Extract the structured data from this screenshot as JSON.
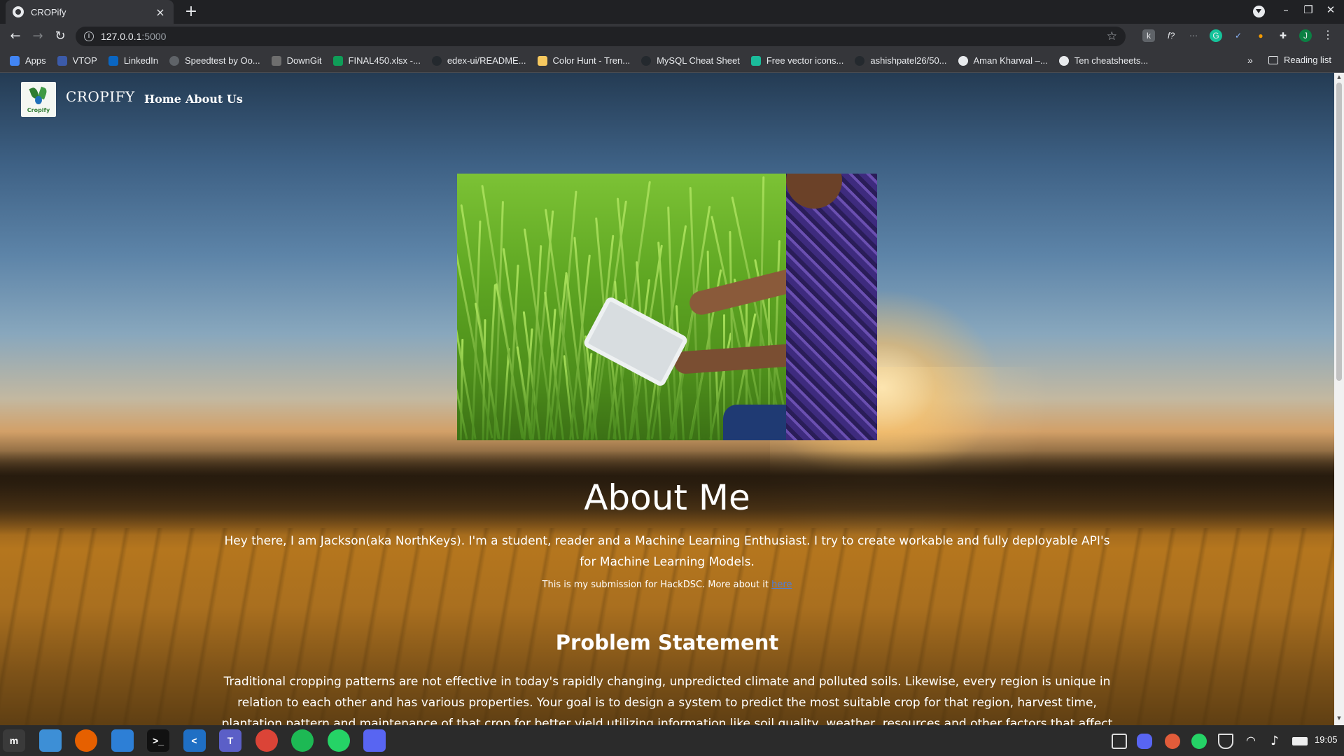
{
  "browser": {
    "tab_title": "CROPify",
    "tab_close": "×",
    "new_tab": "+",
    "url_host": "127.0.0.1",
    "url_port": ":5000",
    "back": "←",
    "forward": "→",
    "reload": "↻",
    "star": "☆",
    "window_minimize": "–",
    "window_restore": "❐",
    "window_close": "✕",
    "extensions": [
      "k",
      "f?",
      "⋯",
      "G",
      "✓",
      "●",
      "✚",
      "J"
    ],
    "menu": "⋮"
  },
  "bookmarks": {
    "items": [
      {
        "label": "Apps",
        "icon": "apps-grid-icon",
        "color": "#4285f4"
      },
      {
        "label": "VTOP",
        "icon": "vtop-icon",
        "color": "#3c5ba9"
      },
      {
        "label": "LinkedIn",
        "icon": "linkedin-icon",
        "color": "#0a66c2"
      },
      {
        "label": "Speedtest by Oo...",
        "icon": "speedtest-icon",
        "color": "#5f6368"
      },
      {
        "label": "DownGit",
        "icon": "downgit-icon",
        "color": "#6e6e6e"
      },
      {
        "label": "FINAL450.xlsx -...",
        "icon": "google-drive-icon",
        "color": "#0f9d58"
      },
      {
        "label": "edex-ui/README...",
        "icon": "github-icon",
        "color": "#24292e"
      },
      {
        "label": "Color Hunt - Tren...",
        "icon": "colorhunt-icon",
        "color": "#f6c85f"
      },
      {
        "label": "MySQL Cheat Sheet",
        "icon": "github-icon",
        "color": "#24292e"
      },
      {
        "label": "Free vector icons...",
        "icon": "flaticon-icon",
        "color": "#1bbc9b"
      },
      {
        "label": "ashishpatel26/50...",
        "icon": "github-icon",
        "color": "#24292e"
      },
      {
        "label": "Aman Kharwal –...",
        "icon": "globe-icon",
        "color": "#e8eaed"
      },
      {
        "label": "Ten cheatsheets...",
        "icon": "globe-icon",
        "color": "#e8eaed"
      }
    ],
    "more": "»",
    "reading_list": "Reading list"
  },
  "site": {
    "brand": "CROPIFY",
    "logo_text": "Cropify",
    "nav": [
      "Home",
      "About Us"
    ],
    "about_heading": "About Me",
    "intro": "Hey there, I am Jackson(aka NorthKeys). I'm a student, reader and a Machine Learning Enthusiast. I try to create workable and fully deployable API's for Machine Learning Models.",
    "submission_text": "This is my submission for HackDSC. More about it ",
    "submission_link": "here",
    "problem_heading": "Problem Statement",
    "problem_text": "Traditional cropping patterns are not effective in today's rapidly changing, unpredicted climate and polluted soils. Likewise, every region is unique in relation to each other and has various properties. Your goal is to design a system to predict the most suitable crop for that region, harvest time, plantation pattern and maintenance of that crop for better yield utilizing information like soil quality, weather, resources and other factors that affect crop"
  },
  "taskbar": {
    "apps": [
      {
        "name": "menu",
        "color": "#3a3a3a",
        "glyph": "m"
      },
      {
        "name": "files",
        "color": "#3d8fd6",
        "glyph": ""
      },
      {
        "name": "firefox",
        "color": "#e66000",
        "glyph": ""
      },
      {
        "name": "finder",
        "color": "#2d7fd6",
        "glyph": ""
      },
      {
        "name": "terminal",
        "color": "#111111",
        "glyph": ">_"
      },
      {
        "name": "vscode",
        "color": "#1f6fc4",
        "glyph": "<"
      },
      {
        "name": "teams",
        "color": "#5b5fc7",
        "glyph": "T"
      },
      {
        "name": "chrome",
        "color": "#db4437",
        "glyph": ""
      },
      {
        "name": "spotify",
        "color": "#1db954",
        "glyph": ""
      },
      {
        "name": "whatsapp",
        "color": "#25d366",
        "glyph": ""
      },
      {
        "name": "discord",
        "color": "#5865f2",
        "glyph": ""
      }
    ],
    "clock": "19:05"
  }
}
